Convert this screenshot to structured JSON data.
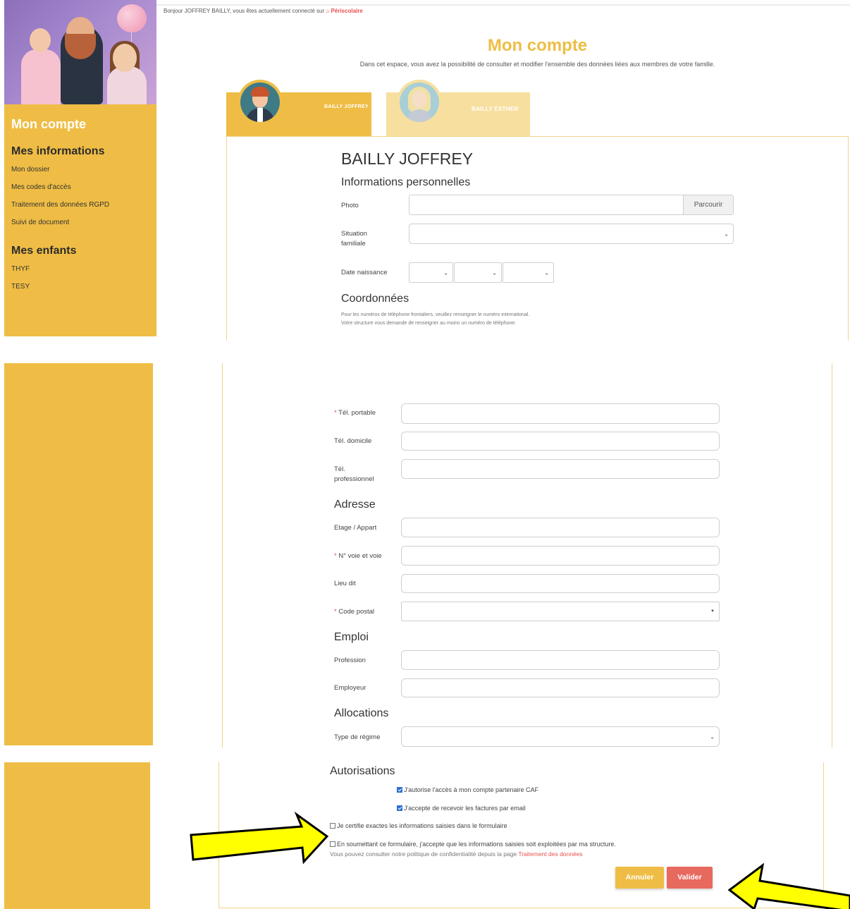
{
  "header": {
    "greeting": "Bonjour JOFFREY BAILLY, vous êtes actuellement connecté sur",
    "portal_icon": "home-icon",
    "portal_name": "Périscolaire"
  },
  "sidebar": {
    "title": "Mon compte",
    "info_heading": "Mes informations",
    "info_items": [
      "Mon dossier",
      "Mes codes d'accès",
      "Traitement des données RGPD",
      "Suivi de document"
    ],
    "children_heading": "Mes enfants",
    "children_items": [
      "THYF",
      "TESY"
    ]
  },
  "page": {
    "title": "Mon compte",
    "intro": "Dans cet espace, vous avez la possibilité de consulter et modifier l'ensemble des données liées aux membres de votre famille."
  },
  "tabs": [
    {
      "name": "BAILLY JOFFREY",
      "active": true
    },
    {
      "name": "BAILLY ESTHER",
      "active": false
    }
  ],
  "form": {
    "person_name": "BAILLY JOFFREY",
    "personal_heading": "Informations personnelles",
    "photo_label": "Photo",
    "photo_value": "",
    "browse_label": "Parcourir",
    "family_status_label": "Situation familiale",
    "family_status_value": "",
    "birth_date_label": "Date naissance",
    "contact_heading": "Coordonnées",
    "contact_note_1": "Pour les numéros de téléphone frontaliers, veuillez renseigner le numéro international.",
    "contact_note_2": "Votre structure vous demande de renseigner au moins un numéro de téléphone.",
    "required_mark": "*",
    "mobile_label": "Tél. portable",
    "home_phone_label": "Tél. domicile",
    "work_phone_label": "Tél. professionnel",
    "address_heading": "Adresse",
    "floor_label": "Etage / Appart",
    "street_label": "N° voie et voie",
    "locality_label": "Lieu dit",
    "postal_label": "Code postal",
    "job_heading": "Emploi",
    "profession_label": "Profession",
    "employer_label": "Employeur",
    "allowance_heading": "Allocations",
    "regime_label": "Type de régime",
    "auth_heading": "Autorisations",
    "auth_caf": "J'autorise l'accès à mon compte partenaire CAF",
    "auth_caf_checked": true,
    "auth_invoices": "J'accepte de recevoir les factures par email",
    "auth_invoices_checked": true,
    "certify": "Je certifie exactes les informations saisies dans le formulaire",
    "certify_checked": false,
    "consent": "En soumettant ce formulaire, j'accepte que les informations saisies soit exploitées par ma structure.",
    "consent_checked": false,
    "policy_text": "Vous pouvez consulter notre politique de confidentialité depuis la page",
    "policy_link": "Traitement des données",
    "cancel_label": "Annuler",
    "submit_label": "Valider"
  },
  "colors": {
    "accent": "#efbd45",
    "accent_light": "#f7dfa0",
    "danger": "#e8695e",
    "arrow": "#ffff00"
  }
}
